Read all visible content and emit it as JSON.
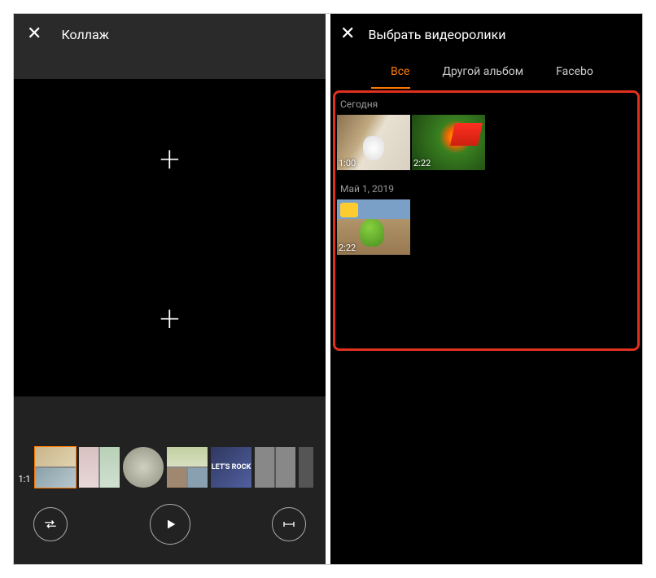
{
  "left": {
    "title": "Коллаж",
    "ratio_label": "1:1",
    "template5_text": "LET'S ROCK"
  },
  "right": {
    "title": "Выбрать видеоролики",
    "tabs": {
      "all": "Все",
      "other": "Другой альбом",
      "facebook": "Facebo"
    },
    "sections": {
      "today": "Сегодня",
      "may": "Май 1, 2019"
    },
    "durations": {
      "v1": "1:00",
      "v2": "2:22",
      "v3": "2:22"
    }
  }
}
